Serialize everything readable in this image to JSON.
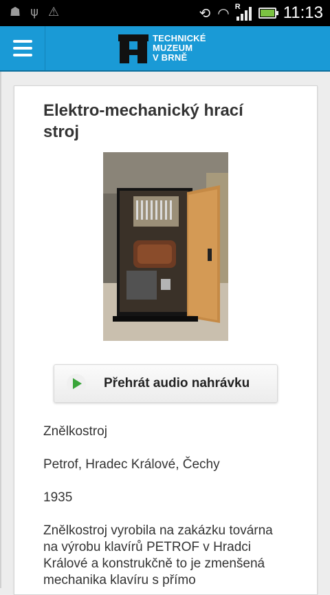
{
  "status_bar": {
    "left_icons": [
      "android-icon",
      "usb-icon",
      "sync-alert-icon"
    ],
    "right_icons": [
      "screen-rotate-icon",
      "wifi-icon",
      "signal-icon",
      "battery-charging-icon"
    ],
    "signal_label": "R",
    "time": "11:13",
    "battery_color": "#7bc242"
  },
  "header": {
    "menu_icon": "hamburger-menu-icon",
    "logo_lines": [
      "TECHNICKÉ",
      "MUZEUM",
      "V BRNĚ"
    ],
    "background": "#1a9ad6"
  },
  "exhibit": {
    "title": "Elektro-mechanický hrací stroj",
    "image_alt": "Elektro-mechanický hrací stroj",
    "audio_button_label": "Přehrát audio nahrávku",
    "name": "Znělkostroj",
    "maker": "Petrof, Hradec Králové, Čechy",
    "year": "1935",
    "description": "Znělkostroj vyrobila na zakázku továrna na výrobu klavírů PETROF v Hradci Králové a konstrukčně to je zmenšená mechanika klavíru s přímo"
  }
}
